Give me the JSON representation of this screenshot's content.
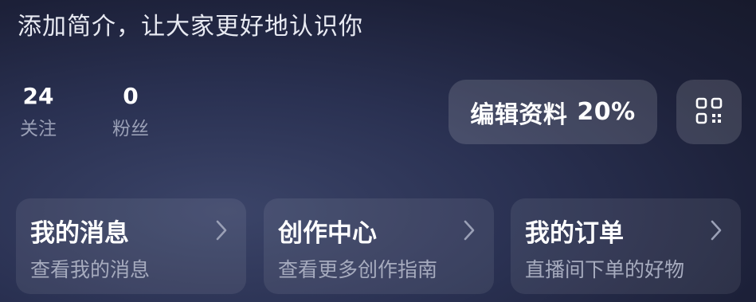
{
  "profile": {
    "bio_placeholder": "添加简介，让大家更好地认识你"
  },
  "stats": [
    {
      "value": "24",
      "label": "关注"
    },
    {
      "value": "0",
      "label": "粉丝"
    }
  ],
  "actions": {
    "edit_profile_label": "编辑资料",
    "edit_profile_percent": "20%",
    "qr_icon": "qr-code-icon"
  },
  "cards": [
    {
      "title": "我的消息",
      "subtitle": "查看我的消息",
      "icon": "chevron-right-icon"
    },
    {
      "title": "创作中心",
      "subtitle": "查看更多创作指南",
      "icon": "chevron-right-icon"
    },
    {
      "title": "我的订单",
      "subtitle": "直播间下单的好物",
      "icon": "chevron-right-icon"
    }
  ]
}
